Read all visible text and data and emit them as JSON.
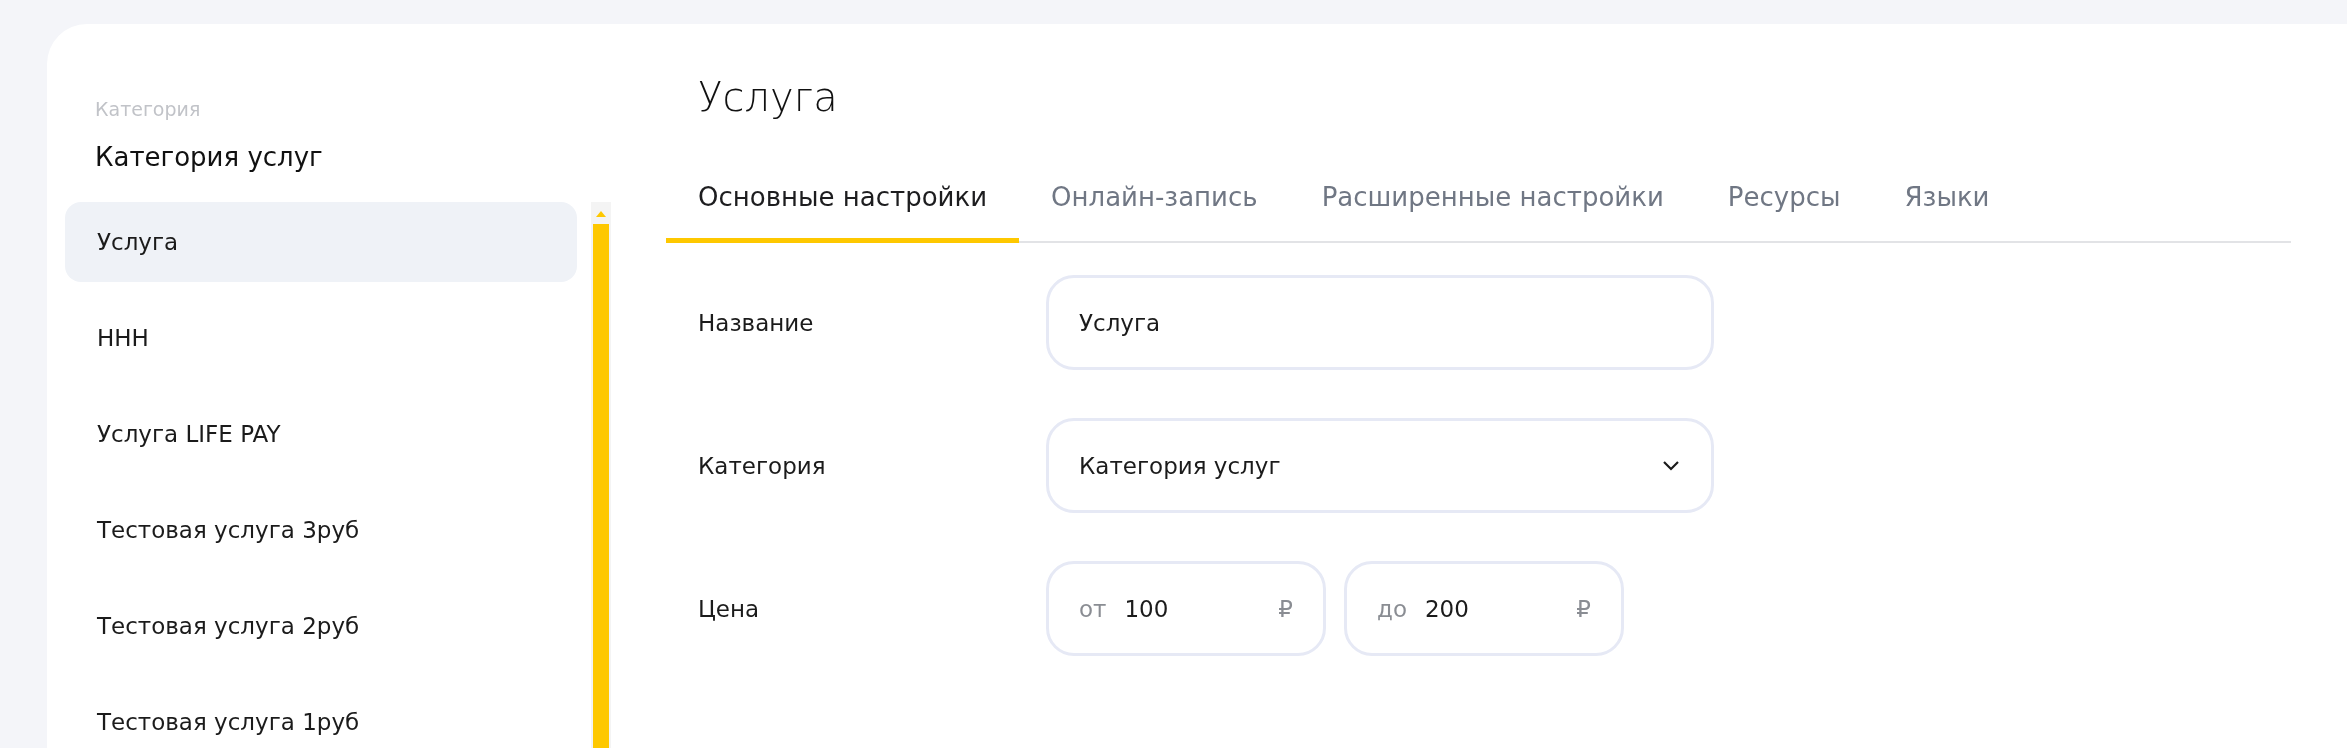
{
  "sidebar": {
    "caption": "Категория",
    "title": "Категория услуг",
    "items": [
      {
        "label": "Услуга",
        "selected": true
      },
      {
        "label": "HHH",
        "selected": false
      },
      {
        "label": "Услуга LIFE PAY",
        "selected": false
      },
      {
        "label": "Тестовая услуга 3руб",
        "selected": false
      },
      {
        "label": "Тестовая услуга 2руб",
        "selected": false
      },
      {
        "label": "Тестовая услуга 1руб",
        "selected": false
      }
    ]
  },
  "main": {
    "title": "Услуга",
    "tabs": [
      {
        "label": "Основные настройки",
        "selected": true
      },
      {
        "label": "Онлайн-запись",
        "selected": false
      },
      {
        "label": "Расширенные настройки",
        "selected": false
      },
      {
        "label": "Ресурсы",
        "selected": false
      },
      {
        "label": "Языки",
        "selected": false
      }
    ],
    "form": {
      "name": {
        "label": "Название",
        "value": "Услуга"
      },
      "category": {
        "label": "Категория",
        "value": "Категория услуг"
      },
      "price": {
        "label": "Цена",
        "ranges": [
          {
            "prefix": "от",
            "value": "100",
            "currency": "₽"
          },
          {
            "prefix": "до",
            "value": "200",
            "currency": "₽"
          }
        ]
      }
    }
  }
}
